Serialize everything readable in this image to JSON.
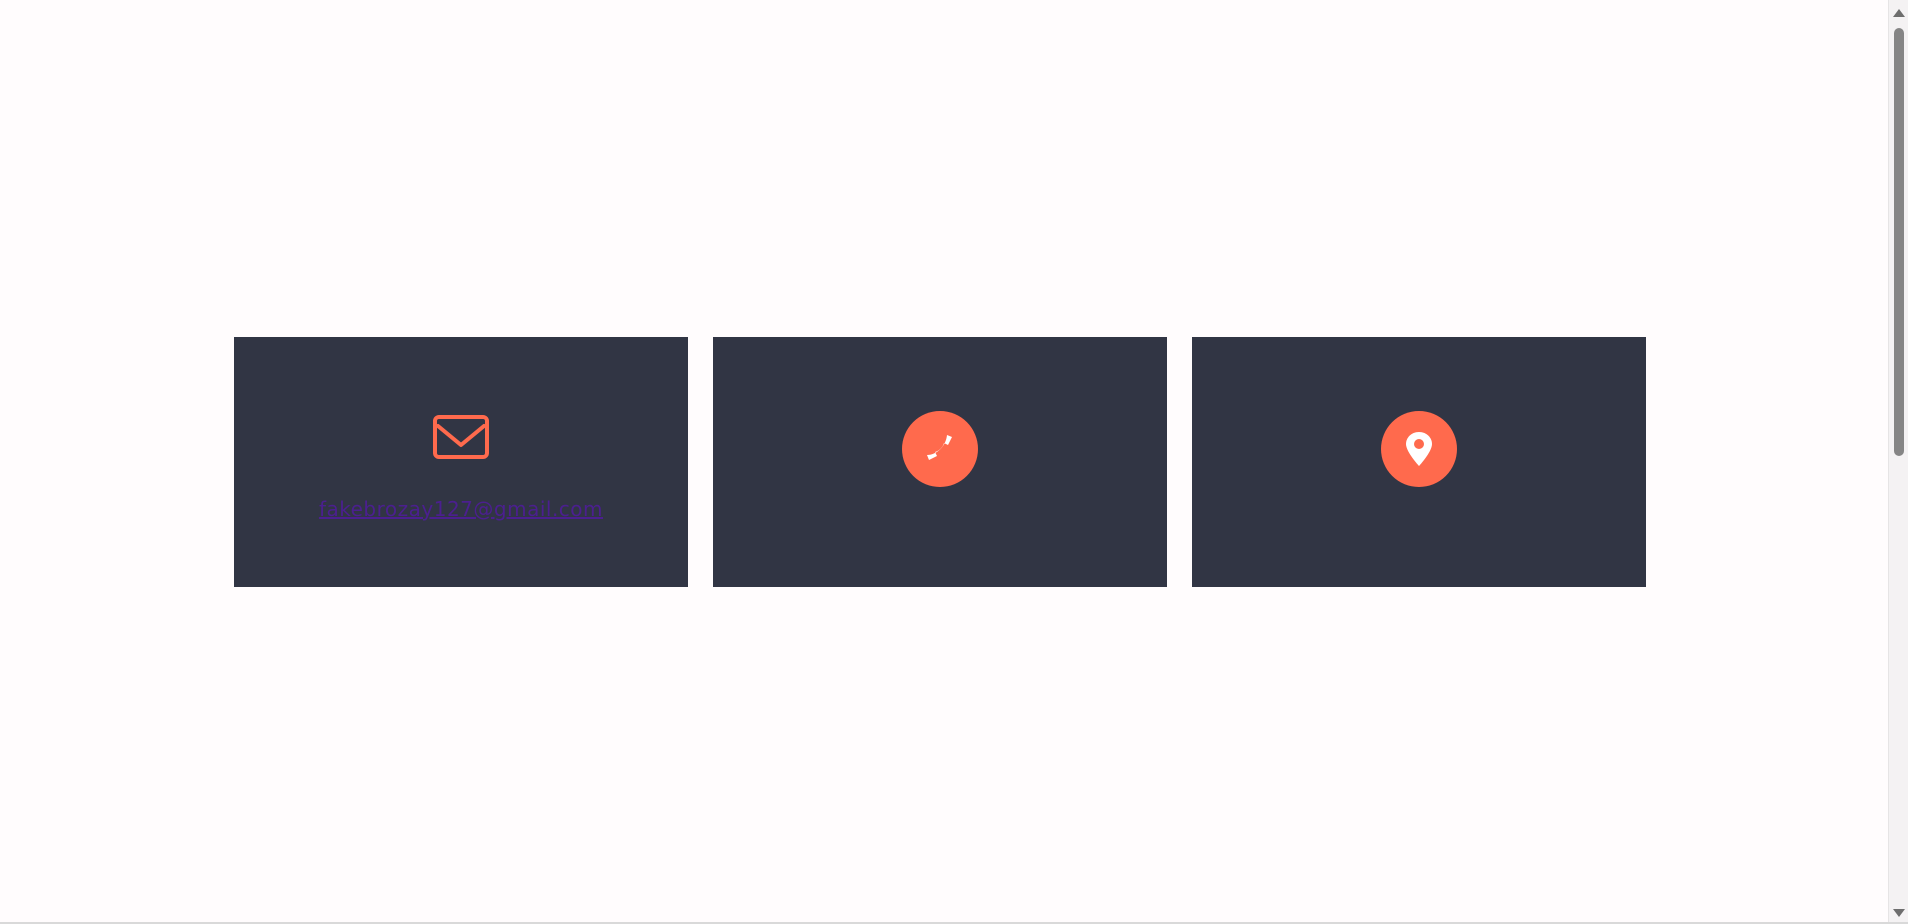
{
  "contact": {
    "email_card": {
      "icon": "envelope-icon",
      "email": "fakebrozay127@gmail.com"
    },
    "phone_card": {
      "icon": "phone-icon"
    },
    "location_card": {
      "icon": "map-pin-icon"
    }
  },
  "colors": {
    "card_background": "#313544",
    "accent": "#ff6a4d",
    "link": "#4b1f8f",
    "page_background": "#fffcfd"
  },
  "scrollbar": {
    "up_icon": "triangle-up-icon",
    "down_icon": "triangle-down-icon"
  }
}
